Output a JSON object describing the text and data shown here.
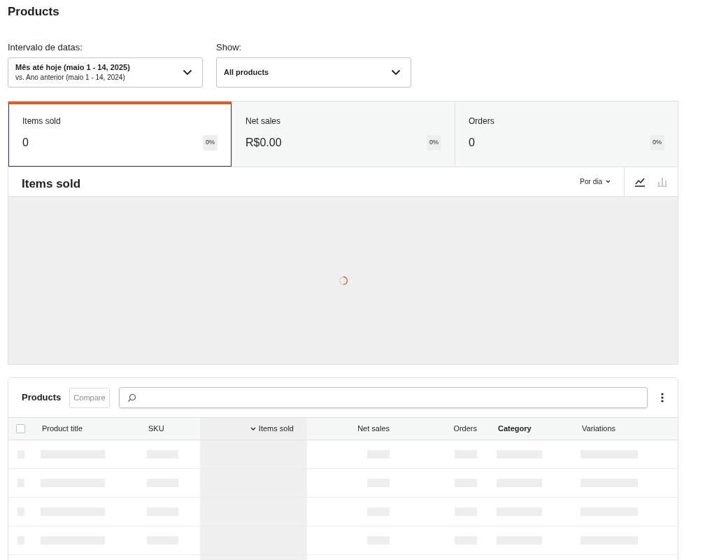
{
  "page_title": "Products",
  "filters": [
    {
      "label": "Intervalo de datas:",
      "value": "Mês até hoje (maio 1 - 14, 2025)",
      "secondary": "vs. Ano anterior (maio 1 - 14, 2024)"
    },
    {
      "label": "Show:",
      "value": "All products"
    }
  ],
  "stats": [
    {
      "label": "Items sold",
      "value": "0",
      "delta": "0%",
      "selected": true
    },
    {
      "label": "Net sales",
      "value": "R$0.00",
      "delta": "0%",
      "selected": false
    },
    {
      "label": "Orders",
      "value": "0",
      "delta": "0%",
      "selected": false
    }
  ],
  "chart": {
    "title": "Items sold",
    "interval": "Por dia",
    "loading": true,
    "views": [
      {
        "kind": "line",
        "selected": true
      },
      {
        "kind": "bar",
        "selected": false
      }
    ]
  },
  "table": {
    "title": "Products",
    "compare": "Compare",
    "loading": true,
    "select_all": {
      "checked": false
    },
    "columns": [
      {
        "label": "Product title",
        "sorted": false,
        "emphasized": false,
        "kind": "text"
      },
      {
        "label": "SKU",
        "sorted": false,
        "emphasized": false,
        "kind": "text"
      },
      {
        "label": "Items sold",
        "sorted": true,
        "emphasized": false,
        "kind": "number"
      },
      {
        "label": "Net sales",
        "sorted": false,
        "emphasized": false,
        "kind": "number"
      },
      {
        "label": "Orders",
        "sorted": false,
        "emphasized": false,
        "kind": "number"
      },
      {
        "label": "Category",
        "sorted": false,
        "emphasized": true,
        "kind": "text"
      },
      {
        "label": "Variations",
        "sorted": false,
        "emphasized": false,
        "kind": "text"
      }
    ]
  }
}
